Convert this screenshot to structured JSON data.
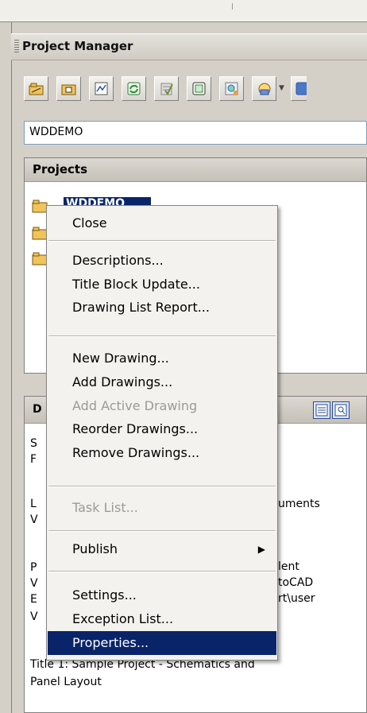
{
  "panel": {
    "title": "Project Manager"
  },
  "toolbar": {
    "icons": [
      "open-project-icon",
      "new-project-icon",
      "new-drawing-icon",
      "refresh-icon",
      "project-task-list-icon",
      "project-properties-icon",
      "drawing-properties-icon",
      "plot-project-icon",
      "help-icon"
    ]
  },
  "project_field": {
    "value": "WDDEMO"
  },
  "projects": {
    "header": "Projects",
    "selected_item": "WDDEMO"
  },
  "details": {
    "header_initial": "D",
    "lines_left": [
      "S",
      "F",
      "",
      "L",
      "V",
      "",
      "P",
      "V",
      "E",
      "V"
    ],
    "lines_right": [
      "uments",
      "",
      "",
      "",
      "lent",
      "toCAD",
      "rt\\user"
    ],
    "footer_line1": "Title 1: Sample Project - Schematics and",
    "footer_line2": "Panel Layout"
  },
  "context_menu": {
    "items": [
      {
        "label": "Close",
        "state": "enabled"
      },
      {
        "label": "Descriptions...",
        "state": "enabled"
      },
      {
        "label": "Title Block Update...",
        "state": "enabled"
      },
      {
        "label": "Drawing List Report...",
        "state": "enabled"
      },
      {
        "label": "New Drawing...",
        "state": "enabled"
      },
      {
        "label": "Add Drawings...",
        "state": "enabled"
      },
      {
        "label": "Add Active Drawing",
        "state": "disabled"
      },
      {
        "label": "Reorder Drawings...",
        "state": "enabled"
      },
      {
        "label": "Remove Drawings...",
        "state": "enabled"
      },
      {
        "label": "Task List...",
        "state": "disabled"
      },
      {
        "label": "Publish",
        "state": "enabled",
        "submenu": true
      },
      {
        "label": "Settings...",
        "state": "enabled"
      },
      {
        "label": "Exception List...",
        "state": "enabled"
      },
      {
        "label": "Properties...",
        "state": "selected"
      }
    ],
    "submenu_arrow": "▶"
  },
  "colors": {
    "selection": "#0a246a",
    "panel_bg": "#d4d0c8",
    "menu_bg": "#f3f2ee"
  }
}
